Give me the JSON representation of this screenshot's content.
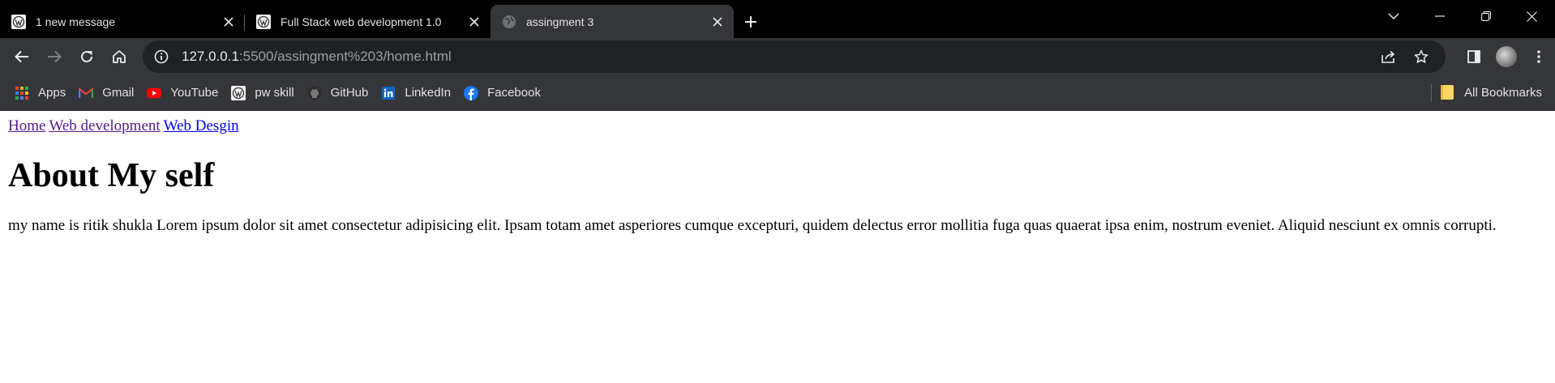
{
  "browser": {
    "tabs": [
      {
        "title": "1 new message",
        "favicon": "wordpress-icon",
        "active": false
      },
      {
        "title": "Full Stack web development 1.0",
        "favicon": "wordpress-icon",
        "active": false
      },
      {
        "title": "assingment 3",
        "favicon": "globe-icon",
        "active": true
      }
    ],
    "address": {
      "host": "127.0.0.1",
      "rest": ":5500/assingment%203/home.html"
    },
    "bookmarks": [
      {
        "label": "Apps",
        "icon": "apps-grid-icon"
      },
      {
        "label": "Gmail",
        "icon": "gmail-icon"
      },
      {
        "label": "YouTube",
        "icon": "youtube-icon"
      },
      {
        "label": "pw skill",
        "icon": "wordpress-icon"
      },
      {
        "label": "GitHub",
        "icon": "github-icon"
      },
      {
        "label": "LinkedIn",
        "icon": "linkedin-icon"
      },
      {
        "label": "Facebook",
        "icon": "facebook-icon"
      }
    ],
    "all_bookmarks_label": "All Bookmarks",
    "colors": {
      "tabstrip_bg": "#000000",
      "toolbar_bg": "#35363a",
      "omnibox_bg": "#202124"
    }
  },
  "page": {
    "nav_links": [
      {
        "label": "Home",
        "visited": true
      },
      {
        "label": "Web development",
        "visited": true
      },
      {
        "label": "Web Desgin",
        "visited": false
      }
    ],
    "heading": "About My self",
    "paragraph": "my name is ritik shukla Lorem ipsum dolor sit amet consectetur adipisicing elit. Ipsam totam amet asperiores cumque excepturi, quidem delectus error mollitia fuga quas quaerat ipsa enim, nostrum eveniet. Aliquid nesciunt ex omnis corrupti.",
    "link_colors": {
      "visited": "#551a8b",
      "unvisited": "#0000ee"
    }
  }
}
